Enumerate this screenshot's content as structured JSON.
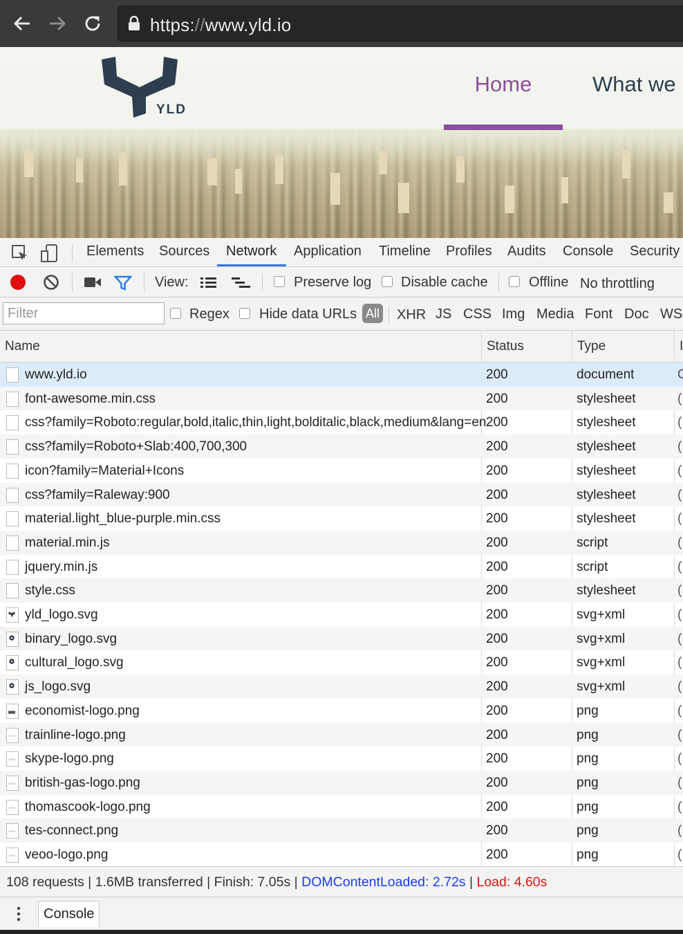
{
  "browser": {
    "url_scheme": "https:",
    "url_slashes": "//",
    "url_host": "www.yld.io"
  },
  "site": {
    "logo_text": "YLD",
    "nav": {
      "home": "Home",
      "what": "What we"
    }
  },
  "devtools": {
    "tabs": [
      "Elements",
      "Sources",
      "Network",
      "Application",
      "Timeline",
      "Profiles",
      "Audits",
      "Console",
      "Security"
    ],
    "active_tab": "Network",
    "toolbar": {
      "view_label": "View:",
      "preserve_log": "Preserve log",
      "disable_cache": "Disable cache",
      "offline": "Offline",
      "throttling": "No throttling"
    },
    "filter": {
      "placeholder": "Filter",
      "regex": "Regex",
      "hide_data_urls": "Hide data URLs",
      "all": "All",
      "types": [
        "XHR",
        "JS",
        "CSS",
        "Img",
        "Media",
        "Font",
        "Doc",
        "WS"
      ]
    },
    "columns": {
      "name": "Name",
      "status": "Status",
      "type": "Type",
      "extra": "I"
    },
    "rows": [
      {
        "name": "www.yld.io",
        "status": "200",
        "type": "document",
        "extra": "C",
        "icon": "file-icon"
      },
      {
        "name": "font-awesome.min.css",
        "status": "200",
        "type": "stylesheet",
        "extra": "(",
        "icon": "file-icon"
      },
      {
        "name": "css?family=Roboto:regular,bold,italic,thin,light,bolditalic,black,medium&lang=en",
        "status": "200",
        "type": "stylesheet",
        "extra": "(",
        "icon": "file-icon"
      },
      {
        "name": "css?family=Roboto+Slab:400,700,300",
        "status": "200",
        "type": "stylesheet",
        "extra": "(",
        "icon": "file-icon"
      },
      {
        "name": "icon?family=Material+Icons",
        "status": "200",
        "type": "stylesheet",
        "extra": "(",
        "icon": "file-icon"
      },
      {
        "name": "css?family=Raleway:900",
        "status": "200",
        "type": "stylesheet",
        "extra": "(",
        "icon": "file-icon"
      },
      {
        "name": "material.light_blue-purple.min.css",
        "status": "200",
        "type": "stylesheet",
        "extra": "(",
        "icon": "file-icon"
      },
      {
        "name": "material.min.js",
        "status": "200",
        "type": "script",
        "extra": "(",
        "icon": "file-icon"
      },
      {
        "name": "jquery.min.js",
        "status": "200",
        "type": "script",
        "extra": "(",
        "icon": "file-icon"
      },
      {
        "name": "style.css",
        "status": "200",
        "type": "stylesheet",
        "extra": "(",
        "icon": "file-icon"
      },
      {
        "name": "yld_logo.svg",
        "status": "200",
        "type": "svg+xml",
        "extra": "(",
        "icon": "yld-logo-thumb-icon"
      },
      {
        "name": "binary_logo.svg",
        "status": "200",
        "type": "svg+xml",
        "extra": "(",
        "icon": "hex-logo-thumb-icon"
      },
      {
        "name": "cultural_logo.svg",
        "status": "200",
        "type": "svg+xml",
        "extra": "(",
        "icon": "hex-logo-thumb-icon"
      },
      {
        "name": "js_logo.svg",
        "status": "200",
        "type": "svg+xml",
        "extra": "(",
        "icon": "hex-logo-thumb-icon"
      },
      {
        "name": "economist-logo.png",
        "status": "200",
        "type": "png",
        "extra": "(",
        "icon": "bar-logo-thumb-icon"
      },
      {
        "name": "trainline-logo.png",
        "status": "200",
        "type": "png",
        "extra": "(",
        "icon": "image-thumb-icon"
      },
      {
        "name": "skype-logo.png",
        "status": "200",
        "type": "png",
        "extra": "(",
        "icon": "image-thumb-icon"
      },
      {
        "name": "british-gas-logo.png",
        "status": "200",
        "type": "png",
        "extra": "(",
        "icon": "image-thumb-icon"
      },
      {
        "name": "thomascook-logo.png",
        "status": "200",
        "type": "png",
        "extra": "(",
        "icon": "image-thumb-icon"
      },
      {
        "name": "tes-connect.png",
        "status": "200",
        "type": "png",
        "extra": "(",
        "icon": "image-thumb-icon"
      },
      {
        "name": "veoo-logo.png",
        "status": "200",
        "type": "png",
        "extra": "(",
        "icon": "image-thumb-icon"
      }
    ],
    "summary": {
      "requests": "108 requests",
      "transferred": "1.6MB transferred",
      "finish": "Finish: 7.05s",
      "dom_loaded": "DOMContentLoaded: 2.72s",
      "load": "Load: 4.60s",
      "separator": "|"
    },
    "drawer": {
      "console_tab": "Console"
    }
  },
  "colors": {
    "accent_purple": "#8c4f9a",
    "logo_navy": "#2c3e50",
    "devtools_blue": "#3879d9",
    "dom_loaded_blue": "#1a3ee8",
    "load_red": "#d6150e",
    "record_red": "#e01010"
  }
}
